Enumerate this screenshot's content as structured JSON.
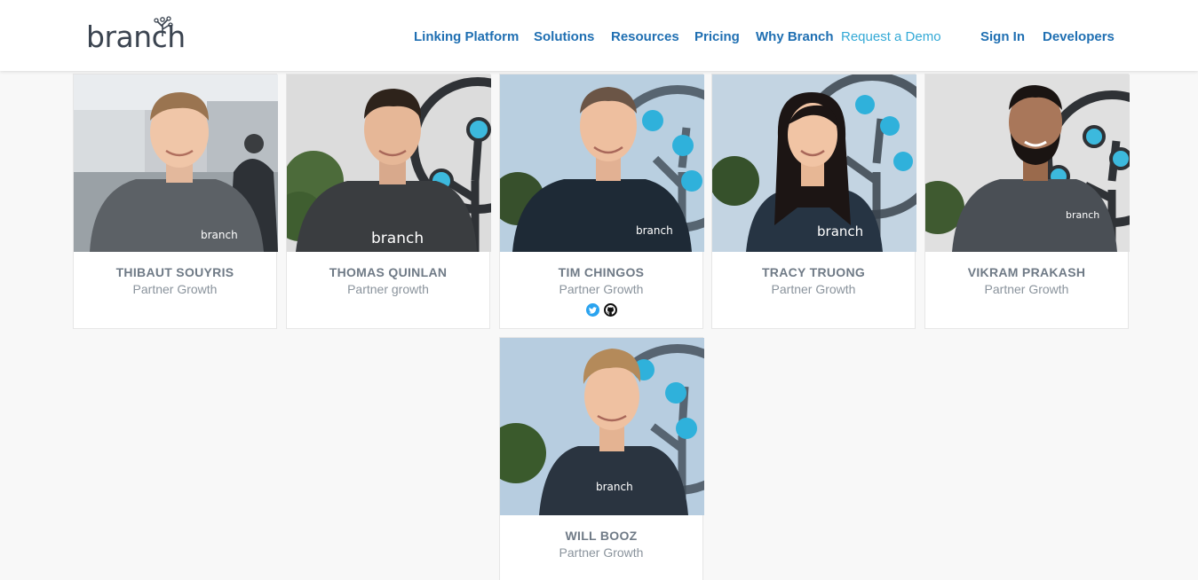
{
  "header": {
    "logo_text": "branch",
    "nav": [
      {
        "label": "Linking Platform"
      },
      {
        "label": "Solutions"
      },
      {
        "label": "Resources"
      },
      {
        "label": "Pricing"
      },
      {
        "label": "Why Branch"
      },
      {
        "label": "Request a Demo"
      },
      {
        "label": "Sign In"
      },
      {
        "label": "Developers"
      }
    ]
  },
  "colors": {
    "nav_link": "#1f6fb2",
    "demo_link": "#33a9d6",
    "name_text": "#6f7a86",
    "role_text": "#8a939c",
    "brand_dot": "#3cb9dd",
    "page_bg": "#f8f8f8"
  },
  "team": [
    {
      "name": "THIBAUT SOUYRIS",
      "role": "Partner Growth",
      "shirt_text": "branch"
    },
    {
      "name": "THOMAS QUINLAN",
      "role": "Partner growth",
      "shirt_text": "branch"
    },
    {
      "name": "TIM CHINGOS",
      "role": "Partner Growth",
      "shirt_text": "branch",
      "socials": [
        "twitter-icon",
        "github-icon"
      ]
    },
    {
      "name": "TRACY TRUONG",
      "role": "Partner Growth",
      "shirt_text": "branch"
    },
    {
      "name": "VIKRAM PRAKASH",
      "role": "Partner Growth",
      "shirt_text": "branch"
    },
    {
      "name": "WILL BOOZ",
      "role": "Partner Growth",
      "shirt_text": "branch"
    }
  ]
}
